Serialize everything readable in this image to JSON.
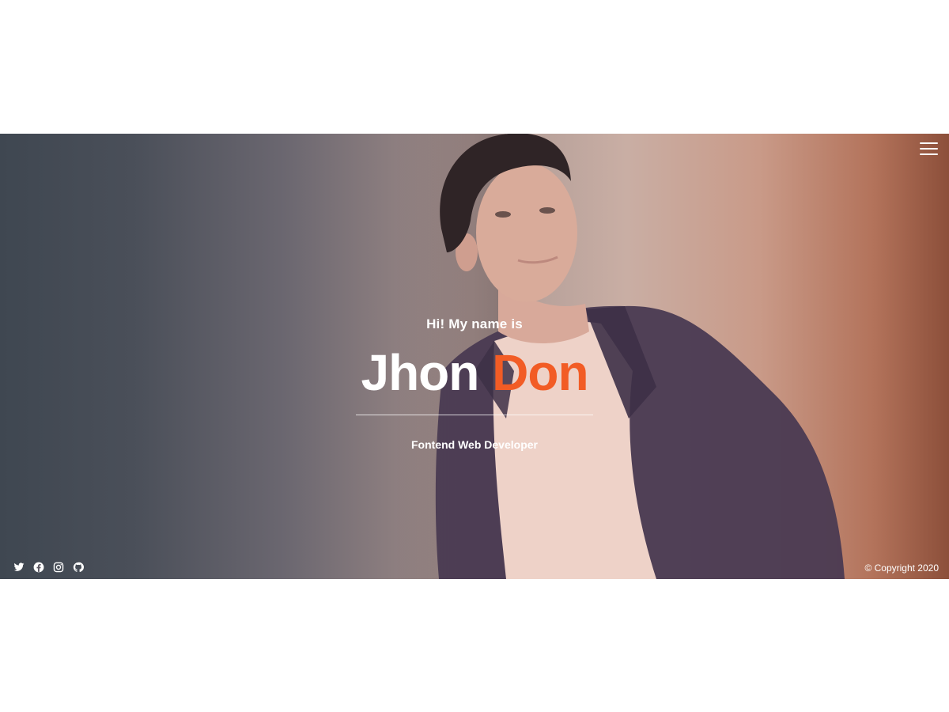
{
  "hero": {
    "greeting": "Hi! My name is",
    "first_name": "Jhon",
    "last_name": "Don",
    "role": "Fontend Web Developer",
    "accent_color": "#f25c25"
  },
  "nav": {
    "menu_icon": "hamburger-menu-icon"
  },
  "social": [
    {
      "icon": "twitter-icon"
    },
    {
      "icon": "facebook-icon"
    },
    {
      "icon": "instagram-icon"
    },
    {
      "icon": "github-icon"
    }
  ],
  "footer": {
    "copyright": "© Copyright 2020"
  }
}
